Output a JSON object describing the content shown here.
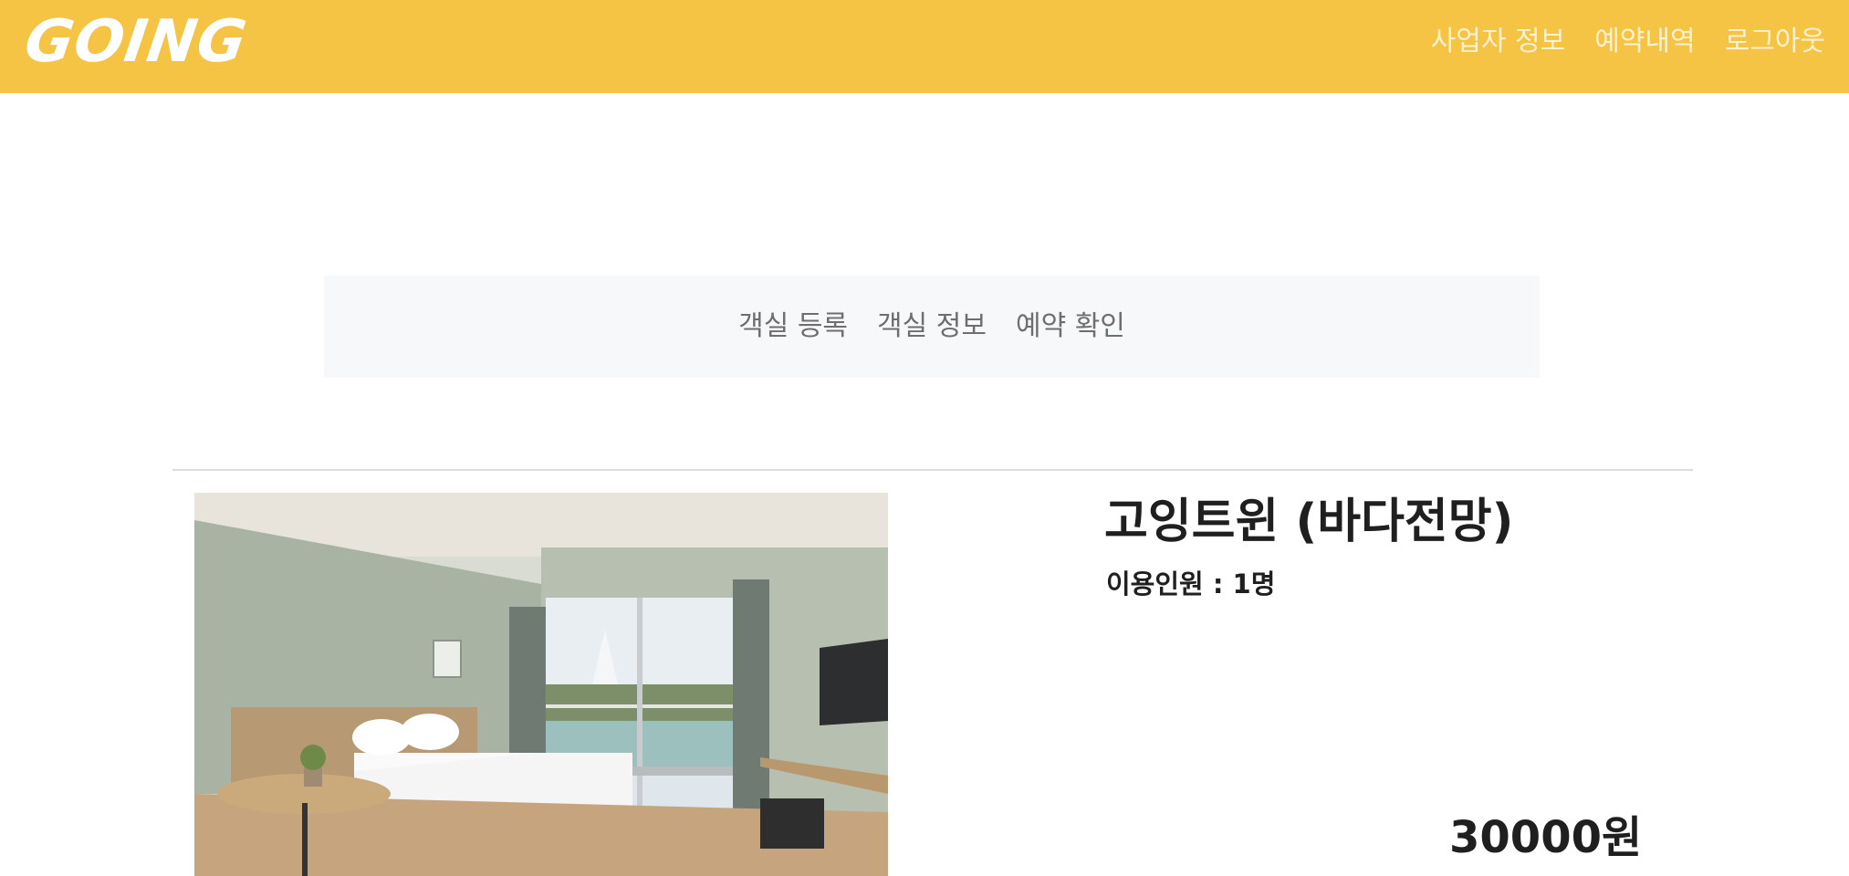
{
  "header": {
    "logo_text": "GOING",
    "nav": [
      {
        "label": "사업자 정보"
      },
      {
        "label": "예약내역"
      },
      {
        "label": "로그아웃"
      }
    ],
    "background_color": "#f5c444"
  },
  "subnav": {
    "items": [
      {
        "label": "객실 등록"
      },
      {
        "label": "객실 정보"
      },
      {
        "label": "예약 확인"
      }
    ]
  },
  "room": {
    "name": "고잉트윈 (바다전망)",
    "capacity_label": "이용인원 : ",
    "capacity_value": "1명",
    "price": "30000원",
    "photo_icon": "hotel-room-photo"
  }
}
